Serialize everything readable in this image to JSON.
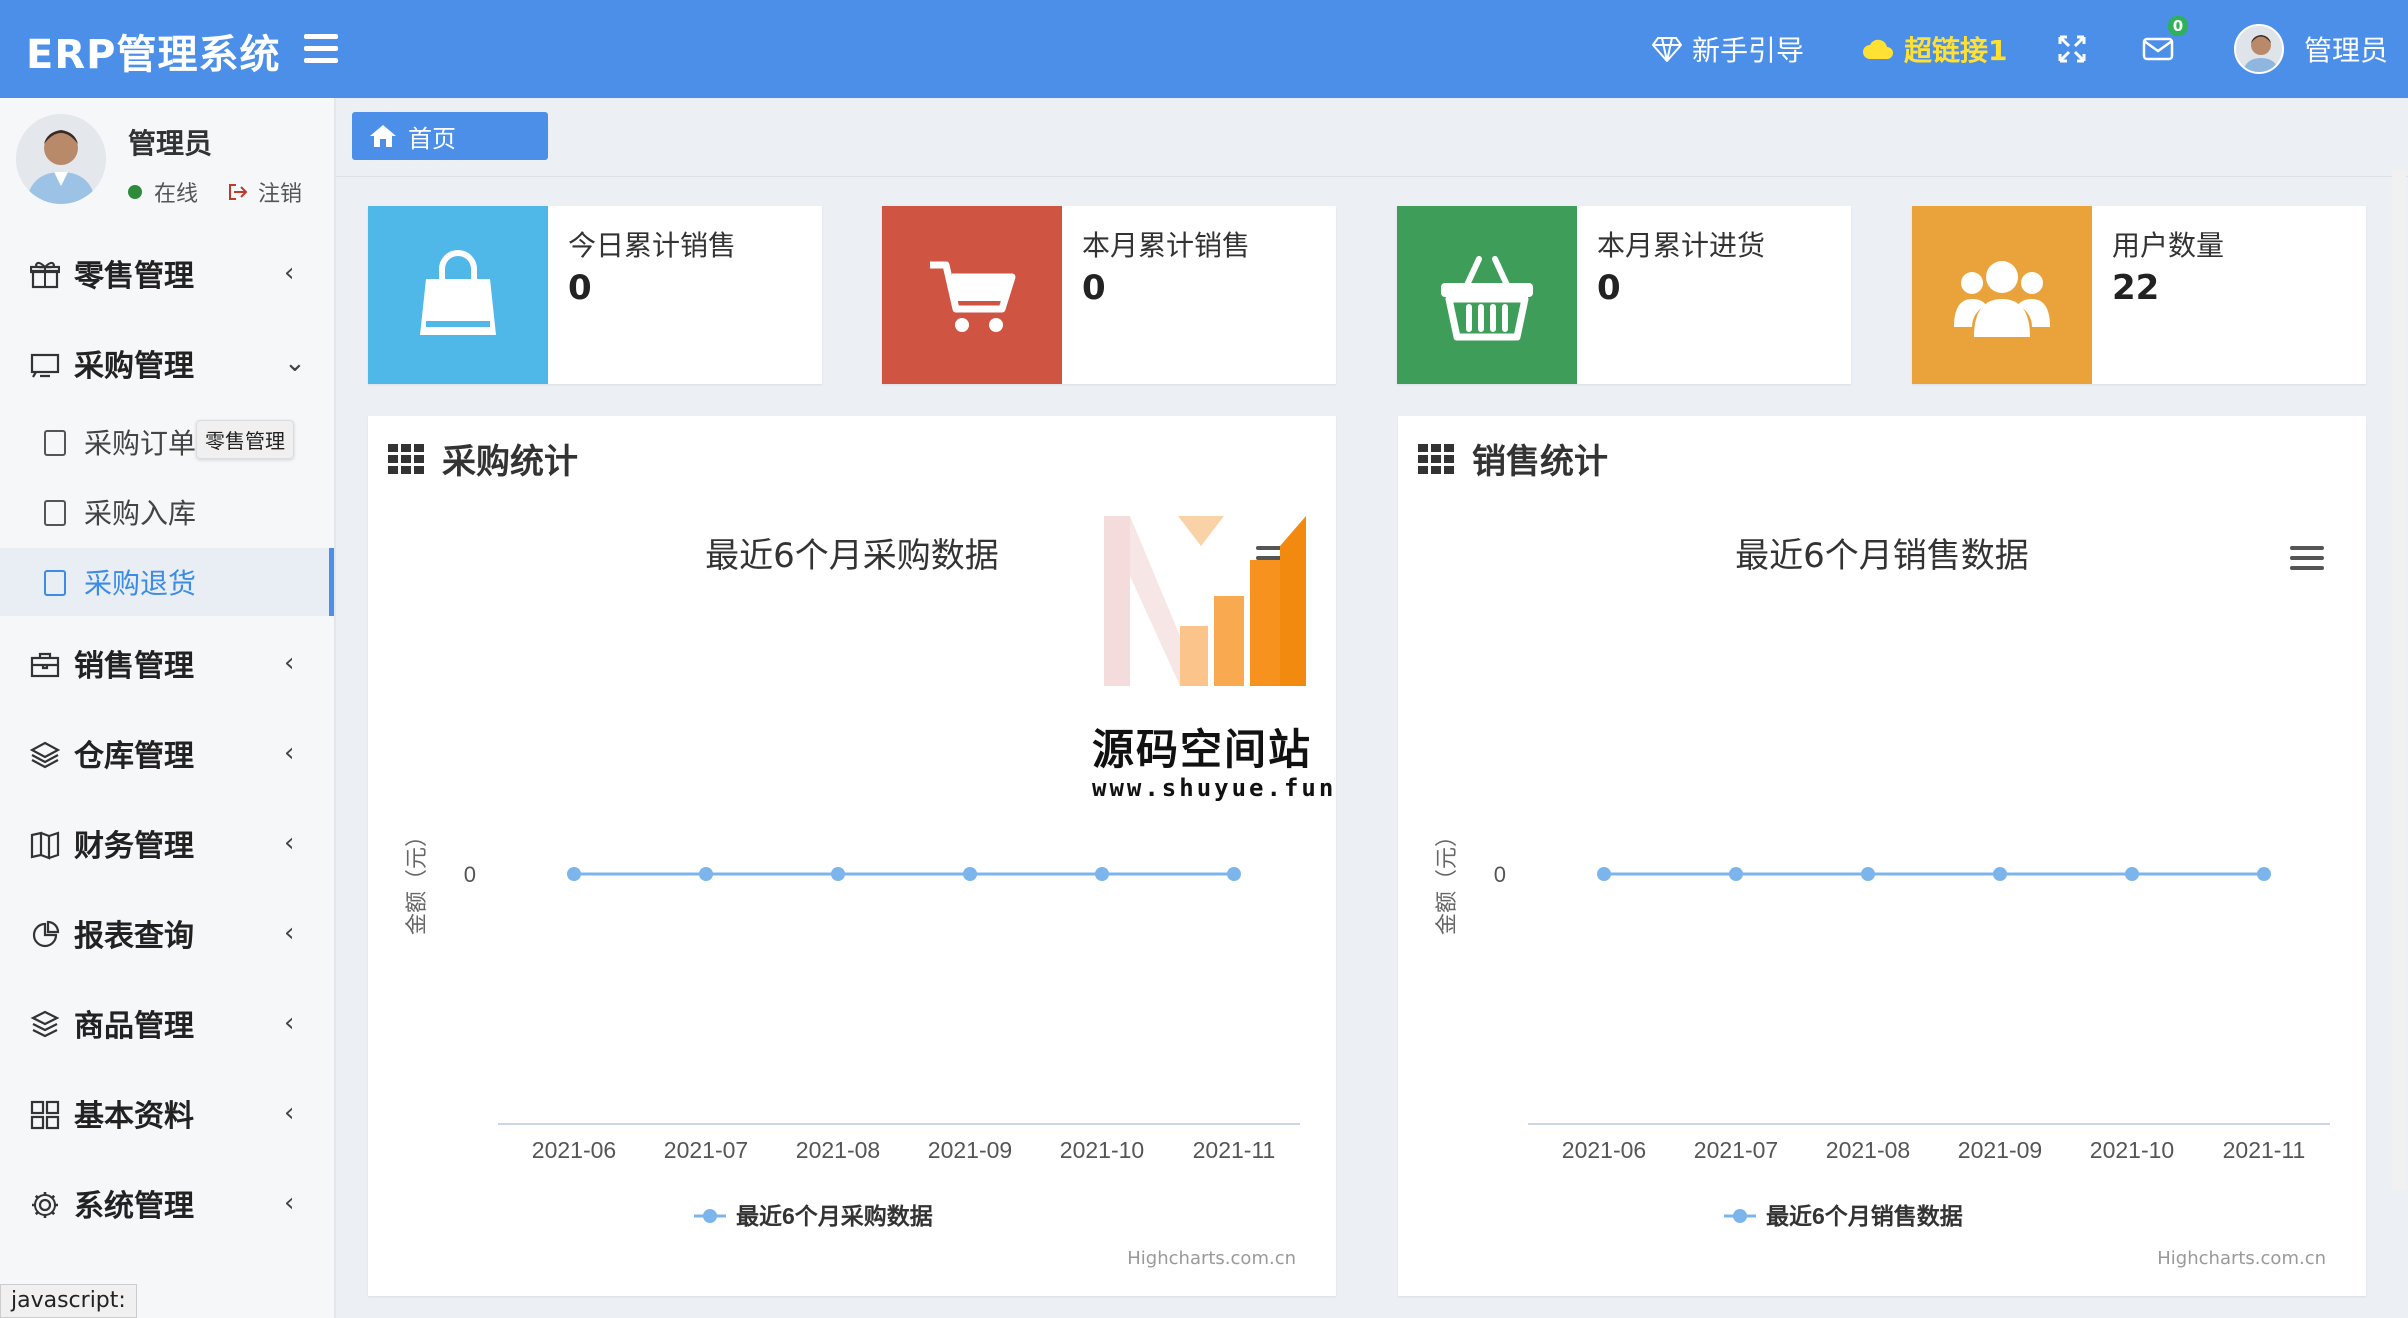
{
  "header": {
    "logo": "ERP管理系统",
    "guide_label": "新手引导",
    "link_label": "超链接1",
    "mail_count": "0",
    "user_name": "管理员"
  },
  "sidebar": {
    "user_name": "管理员",
    "status": "在线",
    "logout": "注销",
    "tooltip": "零售管理",
    "menu": [
      {
        "label": "零售管理",
        "icon": "gift-icon"
      },
      {
        "label": "采购管理",
        "icon": "monitor-icon"
      },
      {
        "label": "销售管理",
        "icon": "briefcase-icon"
      },
      {
        "label": "仓库管理",
        "icon": "layers-icon"
      },
      {
        "label": "财务管理",
        "icon": "book-icon"
      },
      {
        "label": "报表查询",
        "icon": "pie-icon"
      },
      {
        "label": "商品管理",
        "icon": "stack-icon"
      },
      {
        "label": "基本资料",
        "icon": "grid-icon"
      },
      {
        "label": "系统管理",
        "icon": "gear-icon"
      }
    ],
    "submenu": [
      {
        "label": "采购订单"
      },
      {
        "label": "采购入库"
      },
      {
        "label": "采购退货"
      }
    ]
  },
  "statusbar": "javascript:",
  "breadcrumb": "首页",
  "info_boxes": [
    {
      "label": "今日累计销售",
      "value": "0",
      "color": "#4fb8e8",
      "icon": "shopping-bag-icon"
    },
    {
      "label": "本月累计销售",
      "value": "0",
      "color": "#cf5441",
      "icon": "cart-icon"
    },
    {
      "label": "本月累计进货",
      "value": "0",
      "color": "#3f9d5a",
      "icon": "basket-icon"
    },
    {
      "label": "用户数量",
      "value": "22",
      "color": "#eaa33a",
      "icon": "users-icon"
    }
  ],
  "panels": [
    {
      "title": "采购统计"
    },
    {
      "title": "销售统计"
    }
  ],
  "watermark": {
    "text": "源码空间站",
    "url": "www.shuyue.fun"
  },
  "chart_data": [
    {
      "type": "line",
      "title": "最近6个月采购数据",
      "ylabel": "金额（元）",
      "categories": [
        "2021-06",
        "2021-07",
        "2021-08",
        "2021-09",
        "2021-10",
        "2021-11"
      ],
      "series": [
        {
          "name": "最近6个月采购数据",
          "values": [
            0,
            0,
            0,
            0,
            0,
            0
          ],
          "color": "#7cb5ec"
        }
      ],
      "yticks": [
        "0"
      ],
      "legend": "bottom",
      "credits": "Highcharts.com.cn"
    },
    {
      "type": "line",
      "title": "最近6个月销售数据",
      "ylabel": "金额（元）",
      "categories": [
        "2021-06",
        "2021-07",
        "2021-08",
        "2021-09",
        "2021-10",
        "2021-11"
      ],
      "series": [
        {
          "name": "最近6个月销售数据",
          "values": [
            0,
            0,
            0,
            0,
            0,
            0
          ],
          "color": "#7cb5ec"
        }
      ],
      "yticks": [
        "0"
      ],
      "legend": "bottom",
      "credits": "Highcharts.com.cn"
    }
  ]
}
